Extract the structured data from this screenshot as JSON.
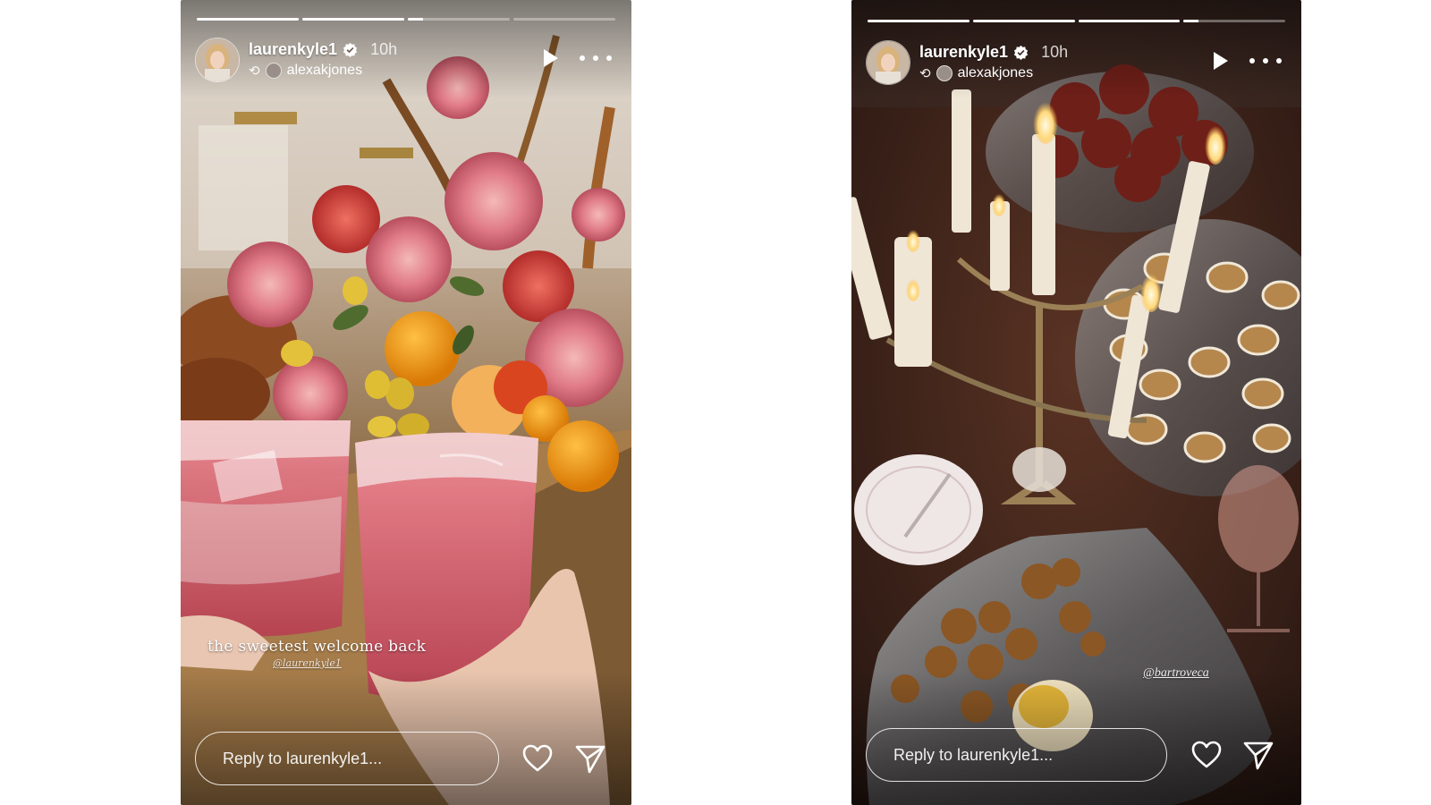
{
  "stories": [
    {
      "username": "laurenkyle1",
      "verified": true,
      "time": "10h",
      "reposted_from": "alexakjones",
      "progress": [
        1,
        1,
        0.15,
        0
      ],
      "caption": "the sweetest welcome back",
      "caption_mention": "@laurenkyle1",
      "reply_placeholder": "Reply to laurenkyle1..."
    },
    {
      "username": "laurenkyle1",
      "verified": true,
      "time": "10h",
      "reposted_from": "alexakjones",
      "progress": [
        1,
        1,
        1,
        0.15
      ],
      "photo_mention": "@bartroveca",
      "reply_placeholder": "Reply to laurenkyle1..."
    }
  ],
  "icons": {
    "play": "play-icon",
    "more": "more-options-icon",
    "heart": "heart-icon",
    "send": "send-icon",
    "verified": "verified-badge-icon",
    "repost": "repost-icon"
  },
  "colors": {
    "verified_blue": "#ffffff",
    "bg": "#ffffff"
  }
}
